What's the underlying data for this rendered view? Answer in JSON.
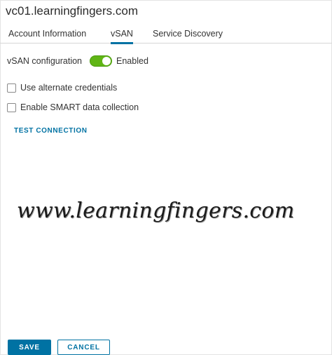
{
  "dialog": {
    "title": "vc01.learningfingers.com"
  },
  "tabs": [
    {
      "label": "Account Information",
      "active": false
    },
    {
      "label": "vSAN",
      "active": true
    },
    {
      "label": "Service Discovery",
      "active": false
    }
  ],
  "vsan": {
    "config_label": "vSAN configuration",
    "toggle_on": true,
    "toggle_state_label": "Enabled",
    "toggle_color": "#60b515"
  },
  "options": {
    "alt_credentials_label": "Use alternate credentials",
    "alt_credentials_checked": false,
    "smart_label": "Enable SMART data collection",
    "smart_checked": false
  },
  "test_connection_label": "TEST CONNECTION",
  "watermark_text": "www.learningfingers.com",
  "footer": {
    "save_label": "SAVE",
    "cancel_label": "CANCEL"
  },
  "colors": {
    "accent": "#0072a3",
    "toggle_on": "#60b515"
  }
}
